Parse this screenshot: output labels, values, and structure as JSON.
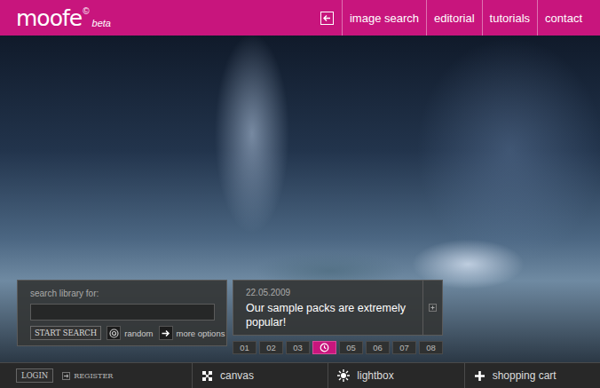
{
  "logo": {
    "name": "moofe",
    "mark": "©",
    "tag": "beta"
  },
  "nav": {
    "items": [
      "image search",
      "editorial",
      "tutorials",
      "contact"
    ]
  },
  "search": {
    "label": "search library for:",
    "value": "",
    "button": "START SEARCH",
    "links": [
      {
        "label": "random",
        "kind": "spiral"
      },
      {
        "label": "more options",
        "kind": "arrow"
      }
    ]
  },
  "news": {
    "date": "22.05.2009",
    "headline": "Our sample packs are extremely popular!",
    "pages": [
      {
        "label": "01",
        "selected": false
      },
      {
        "label": "02",
        "selected": false
      },
      {
        "label": "03",
        "selected": false
      },
      {
        "label": "",
        "selected": true
      },
      {
        "label": "05",
        "selected": false
      },
      {
        "label": "06",
        "selected": false
      },
      {
        "label": "07",
        "selected": false
      },
      {
        "label": "08",
        "selected": false
      }
    ]
  },
  "footer": {
    "login": "LOGIN",
    "register": "REGISTER",
    "tabs": [
      {
        "label": "canvas",
        "kind": "canvas"
      },
      {
        "label": "lightbox",
        "kind": "lightbox"
      },
      {
        "label": "shopping cart",
        "kind": "cart"
      }
    ]
  }
}
